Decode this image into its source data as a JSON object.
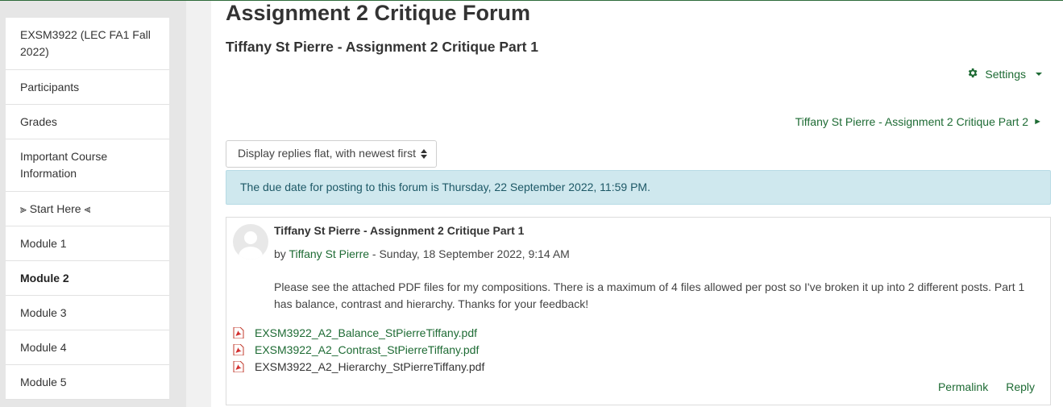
{
  "sidebar": {
    "items": [
      {
        "label": "EXSM3922 (LEC FA1 Fall 2022)"
      },
      {
        "label": "Participants"
      },
      {
        "label": "Grades"
      },
      {
        "label": "Important Course Information"
      },
      {
        "label": "⫸ Start Here ⫷"
      },
      {
        "label": "Module 1"
      },
      {
        "label": "Module 2"
      },
      {
        "label": "Module 3"
      },
      {
        "label": "Module 4"
      },
      {
        "label": "Module 5"
      }
    ]
  },
  "main": {
    "page_title": "Assignment 2 Critique Forum",
    "discussion_title": "Tiffany St Pierre - Assignment 2 Critique Part 1",
    "settings_label": "Settings",
    "next_discussion_label": "Tiffany St Pierre - Assignment 2 Critique Part 2",
    "display_mode": "Display replies flat, with newest first",
    "due_notice": "The due date for posting to this forum is Thursday, 22 September 2022, 11:59 PM."
  },
  "post": {
    "subject": "Tiffany St Pierre - Assignment 2 Critique Part 1",
    "by_prefix": "by",
    "author": "Tiffany St Pierre",
    "date_suffix": " - Sunday, 18 September 2022, 9:14 AM",
    "body": "Please see the attached PDF files for my compositions. There is a maximum of 4 files allowed per post so I've broken  it up into 2 different posts. Part 1 has balance, contrast and hierarchy. Thanks for your feedback!",
    "attachments": [
      {
        "name": "EXSM3922_A2_Balance_StPierreTiffany.pdf"
      },
      {
        "name": "EXSM3922_A2_Contrast_StPierreTiffany.pdf"
      },
      {
        "name": "EXSM3922_A2_Hierarchy_StPierreTiffany.pdf"
      }
    ],
    "permalink_label": "Permalink",
    "reply_label": "Reply"
  },
  "colors": {
    "accent": "#1e6b34",
    "notice_bg": "#cfe8ee",
    "notice_text": "#1d5866"
  },
  "icons": {
    "settings": "gear-icon",
    "next": "arrow-right-icon",
    "attachment": "pdf-icon"
  }
}
